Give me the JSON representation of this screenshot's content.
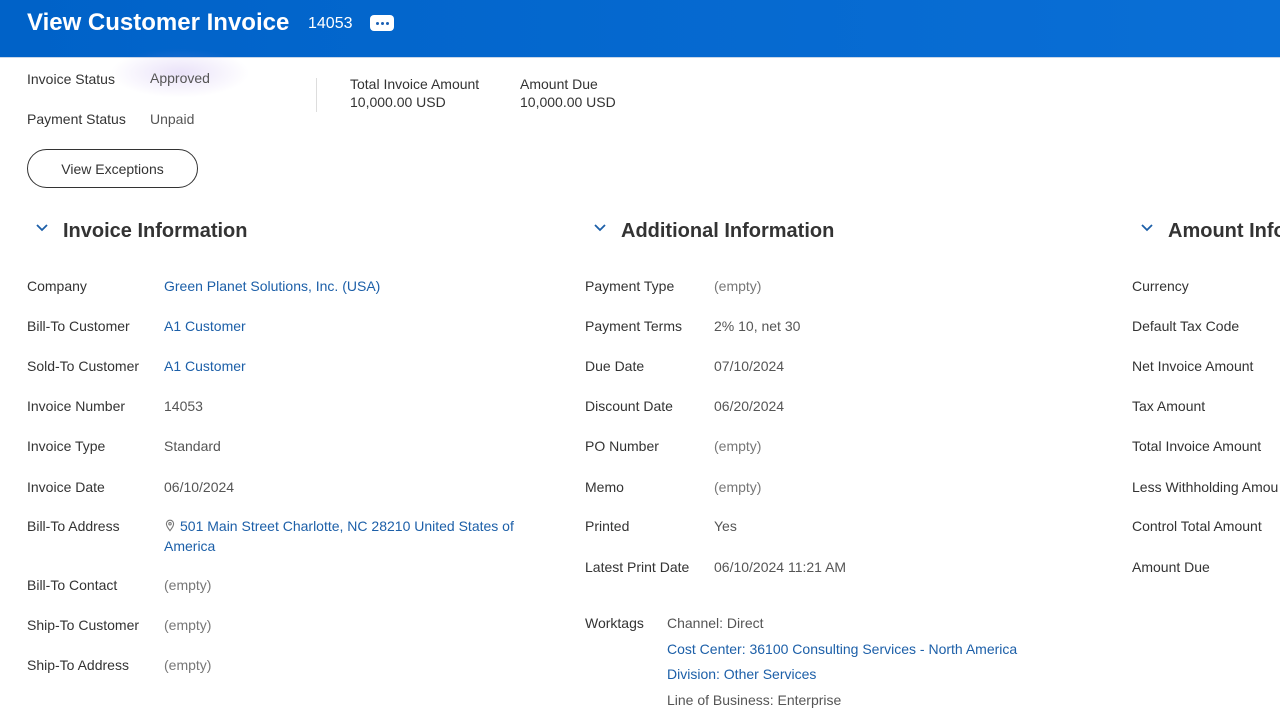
{
  "header": {
    "title": "View Customer Invoice",
    "invoice_id": "14053",
    "more_icon": "ellipsis-icon"
  },
  "summary": {
    "invoice_status_label": "Invoice Status",
    "invoice_status_value": "Approved",
    "payment_status_label": "Payment Status",
    "payment_status_value": "Unpaid",
    "total_invoice_amount_label": "Total Invoice Amount",
    "total_invoice_amount_value": "10,000.00 USD",
    "amount_due_label": "Amount Due",
    "amount_due_value": "10,000.00 USD",
    "view_exceptions_label": "View Exceptions"
  },
  "invoice_info": {
    "title": "Invoice Information",
    "fields": [
      {
        "label": "Company",
        "value": "Green Planet Solutions, Inc. (USA)"
      },
      {
        "label": "Bill-To Customer",
        "value": "A1 Customer"
      },
      {
        "label": "Sold-To Customer",
        "value": "A1 Customer"
      },
      {
        "label": "Invoice Number",
        "value": "14053"
      },
      {
        "label": "Invoice Type",
        "value": "Standard"
      },
      {
        "label": "Invoice Date",
        "value": "06/10/2024"
      },
      {
        "label": "Bill-To Address",
        "value_line1": "501 Main Street Charlotte, NC 28210 United States of",
        "value_line2": "America"
      },
      {
        "label": "Bill-To Contact",
        "value": "(empty)"
      },
      {
        "label": "Ship-To Customer",
        "value": "(empty)"
      },
      {
        "label": "Ship-To Address",
        "value": "(empty)"
      }
    ]
  },
  "additional_info": {
    "title": "Additional Information",
    "fields": [
      {
        "label": "Payment Type",
        "value": "(empty)"
      },
      {
        "label": "Payment Terms",
        "value": "2% 10, net 30"
      },
      {
        "label": "Due Date",
        "value": "07/10/2024"
      },
      {
        "label": "Discount Date",
        "value": "06/20/2024"
      },
      {
        "label": "PO Number",
        "value": "(empty)"
      },
      {
        "label": "Memo",
        "value": "(empty)"
      },
      {
        "label": "Printed",
        "value": "Yes"
      },
      {
        "label": "Latest Print Date",
        "value": "06/10/2024 11:21 AM"
      }
    ],
    "worktags_label": "Worktags",
    "worktags": [
      "Channel: Direct",
      "Cost Center: 36100 Consulting Services - North America",
      "Division: Other Services",
      "Line of Business: Enterprise"
    ]
  },
  "amount_info": {
    "title": "Amount Info",
    "fields": [
      {
        "label": "Currency"
      },
      {
        "label": "Default Tax Code"
      },
      {
        "label": "Net Invoice Amount"
      },
      {
        "label": "Tax Amount"
      },
      {
        "label": "Total Invoice Amount"
      },
      {
        "label": "Less Withholding Amou"
      },
      {
        "label": "Control Total Amount"
      },
      {
        "label": "Amount Due"
      }
    ]
  },
  "colors": {
    "header_blue": "#0062c8",
    "link_blue": "#1c5fa8"
  }
}
